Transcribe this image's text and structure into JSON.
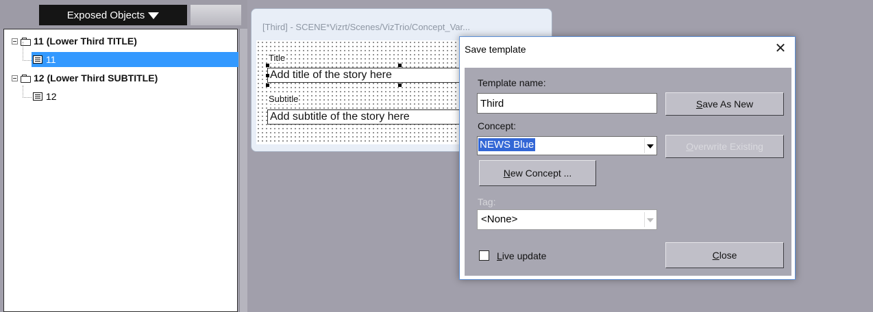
{
  "exposed_panel": {
    "header": "Exposed Objects",
    "items": [
      {
        "label": "11 (Lower Third TITLE)",
        "child": "11",
        "selected": true
      },
      {
        "label": "12 (Lower Third SUBTITLE)",
        "child": "12",
        "selected": false
      }
    ]
  },
  "template_window": {
    "title": "[Third] - SCENE*Vizrt/Scenes/VizTrio/Concept_Var...",
    "fields": [
      {
        "label": "Title",
        "value": "Add title of the story here"
      },
      {
        "label": "Subtitle",
        "value": "Add subtitle of the story here"
      }
    ]
  },
  "dialog": {
    "title": "Save template",
    "close_symbol": "✕",
    "template_name_label": "Template name:",
    "template_name_value": "Third",
    "save_as_new": {
      "pre": "",
      "ul": "S",
      "post": "ave As New"
    },
    "concept_label": "Concept:",
    "concept_value": "NEWS Blue",
    "overwrite_existing": {
      "pre": "",
      "ul": "O",
      "post": "verwrite Existing"
    },
    "new_concept": {
      "pre": "",
      "ul": "N",
      "post": "ew Concept ..."
    },
    "tag_label": "Tag:",
    "tag_value": "<None>",
    "live_update": {
      "pre": "",
      "ul": "L",
      "post": "ive update"
    },
    "close_button": {
      "pre": "",
      "ul": "C",
      "post": "lose"
    }
  },
  "colors": {
    "selection": "#3399ff",
    "dialog_body": "#a8a7b2",
    "highlight": "#3367d6"
  }
}
